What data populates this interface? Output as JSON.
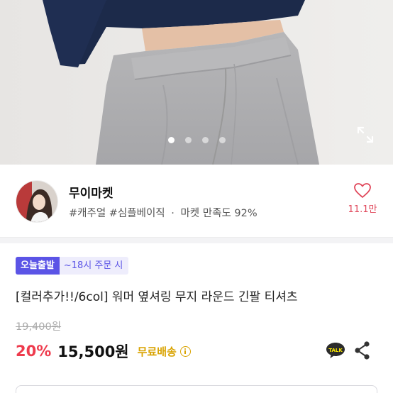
{
  "hero": {
    "slide_count": 4,
    "active_slide": 1
  },
  "seller": {
    "name": "무이마켓",
    "tag1": "#캐주얼",
    "tag2": "#심플베이직",
    "separator": "·",
    "satisfaction": "마켓 만족도 92%",
    "like_count": "11.1만"
  },
  "product": {
    "badge_today": "오늘출발",
    "badge_time": "~18시 주문 시",
    "title": "[컬러추가!!/6col] 워머 옆셔링 무지 라운드 긴팔 티셔츠",
    "original_price": "19,400원",
    "discount": "20%",
    "price": "15,500원",
    "shipping": "무료배송"
  },
  "icons": {
    "expand": "expand-icon",
    "heart": "heart-icon",
    "talk": "talk-icon",
    "share": "share-icon",
    "info": "info-icon"
  },
  "colors": {
    "accent_purple": "#5b54e6",
    "discount_red": "#ee3b4d",
    "like_red": "#e0475a",
    "shipping_gold": "#d9a300"
  }
}
